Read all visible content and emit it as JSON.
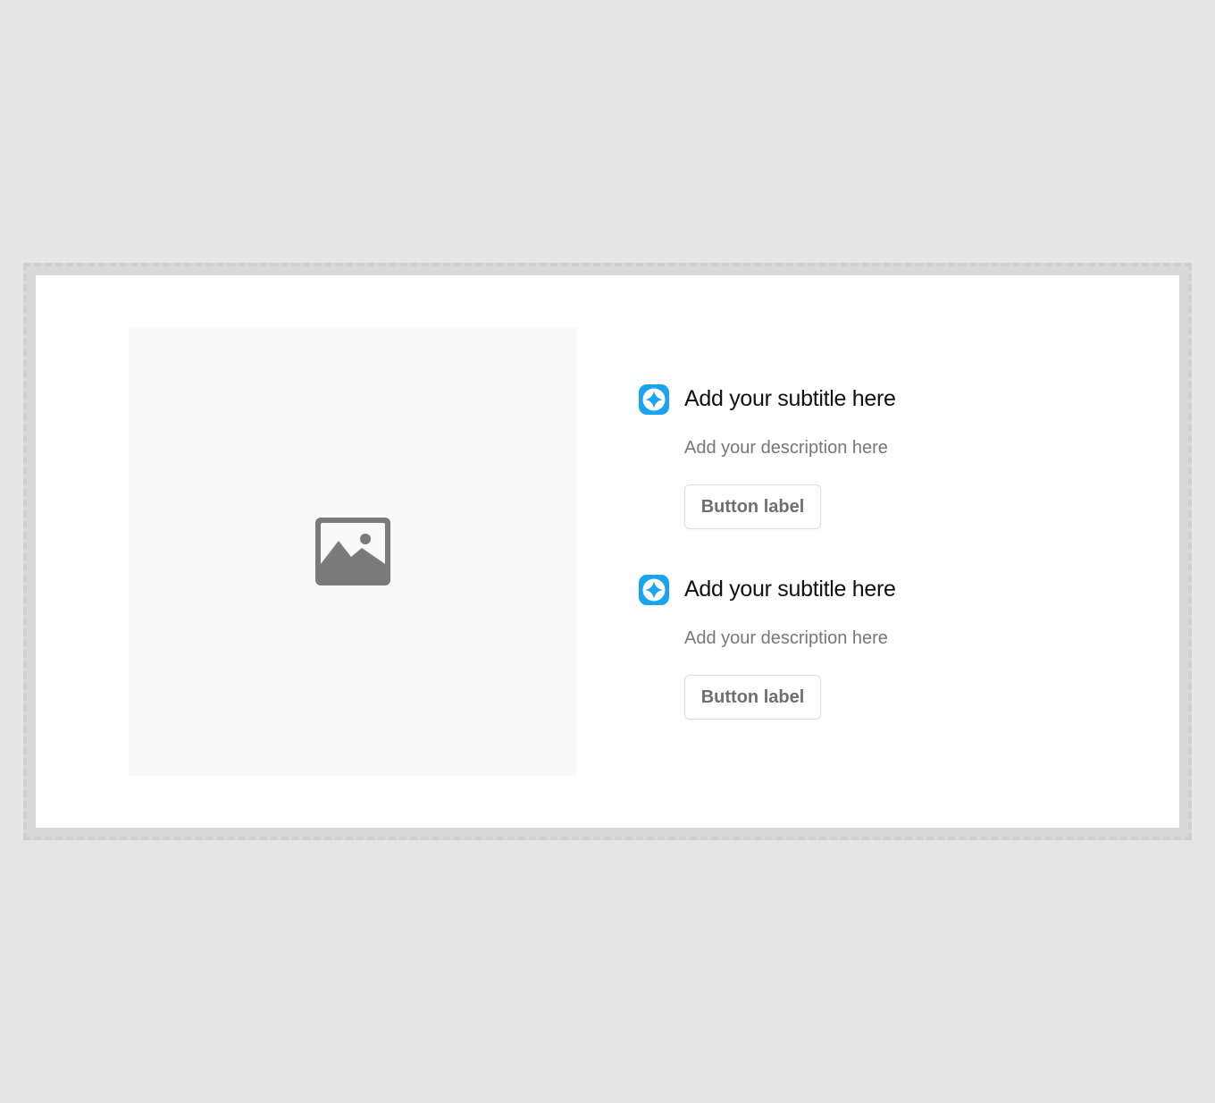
{
  "colors": {
    "page_background": "#e6e6e6",
    "card_background": "#ffffff",
    "image_placeholder_background": "#f9f9f9",
    "image_icon": "#7a7a7a",
    "accent": "#1aa3f0",
    "title_text": "#111111",
    "description_text": "#777777",
    "button_text": "#6f6f6f",
    "button_border": "#dedede"
  },
  "media": {
    "icon": "image-icon"
  },
  "features": [
    {
      "icon": "sparkle-icon",
      "title": "Add your subtitle here",
      "description": "Add your description here",
      "button_label": "Button label"
    },
    {
      "icon": "sparkle-icon",
      "title": "Add your subtitle here",
      "description": "Add your description here",
      "button_label": "Button label"
    }
  ]
}
